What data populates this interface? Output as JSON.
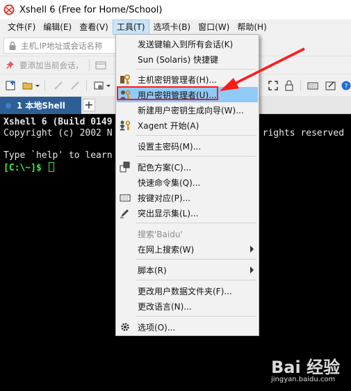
{
  "window": {
    "title": "Xshell 6 (Free for Home/School)"
  },
  "menubar": {
    "items": [
      {
        "label": "文件(F)"
      },
      {
        "label": "编辑(E)"
      },
      {
        "label": "查看(V)"
      },
      {
        "label": "工具(T)",
        "active": true
      },
      {
        "label": "选项卡(B)"
      },
      {
        "label": "窗口(W)"
      },
      {
        "label": "帮助(H)"
      }
    ]
  },
  "address_bar": {
    "placeholder": "主机,IP地址或会话名称"
  },
  "hint_bar": {
    "text": "要添加当前会话，"
  },
  "tabs": [
    {
      "number": "1",
      "label": "本地Shell"
    }
  ],
  "add_tab_label": "+",
  "terminal": {
    "line1": "Xshell 6 (Build 0149",
    "line2": "Copyright (c) 2002 N",
    "line2_right": "l rights reserved",
    "line3": "Type `help' to learn",
    "prompt": "[C:\\~]$ "
  },
  "tools_menu": {
    "items": [
      {
        "label": "发送键输入到所有会话(K)",
        "icon": ""
      },
      {
        "label": "Sun (Solaris) 快捷键",
        "icon": ""
      },
      {
        "label": "主机密钥管理者(H)...",
        "icon": "host-key-icon"
      },
      {
        "label": "用户密钥管理者(U)...",
        "icon": "user-key-icon",
        "highlighted": true
      },
      {
        "label": "新建用户密钥生成向导(W)...",
        "icon": ""
      },
      {
        "label": "Xagent 开始(A)",
        "icon": "xagent-icon"
      },
      {
        "label": "设置主密码(M)...",
        "icon": ""
      },
      {
        "label": "配色方案(C)...",
        "icon": "color-scheme-icon"
      },
      {
        "label": "快速命令集(Q)...",
        "icon": ""
      },
      {
        "label": "按键对应(P)...",
        "icon": "keyboard-icon"
      },
      {
        "label": "突出显示集(L)...",
        "icon": "highlight-icon"
      },
      {
        "label": "搜索'Baidu'",
        "icon": "",
        "disabled": true
      },
      {
        "label": "在网上搜索(W)",
        "icon": "",
        "submenu": true
      },
      {
        "label": "脚本(R)",
        "icon": "",
        "submenu": true
      },
      {
        "label": "更改用户数据文件夹(F)...",
        "icon": ""
      },
      {
        "label": "更改语言(N)...",
        "icon": ""
      },
      {
        "label": "选项(O)...",
        "icon": "gear-icon"
      }
    ]
  },
  "watermark": {
    "main": "Bai  经验",
    "sub": "jingyan.baidu.com"
  },
  "colors": {
    "tab_active": "#2e5f94",
    "menu_highlight": "#91c9f7",
    "annotation_red": "#ff1a1a",
    "prompt_green": "#3ef03e"
  }
}
